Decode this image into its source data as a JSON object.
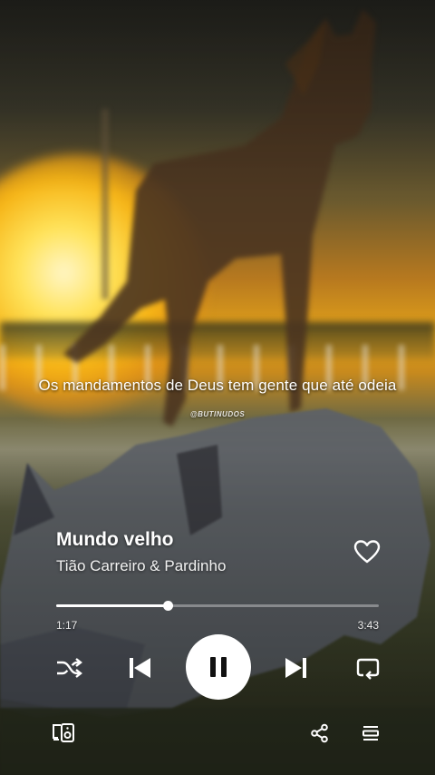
{
  "lyric": {
    "line": "Os mandamentos de Deus tem gente que até odeia"
  },
  "watermark": "@BUTINUDOS",
  "track": {
    "title": "Mundo velho",
    "artist": "Tião Carreiro & Pardinho"
  },
  "progress": {
    "elapsed": "1:17",
    "total": "3:43",
    "fraction": 0.345
  },
  "controls": {
    "shuffle": "shuffle-icon",
    "previous": "skip-previous-icon",
    "play_pause": "pause-icon",
    "next": "skip-next-icon",
    "repeat": "repeat-icon"
  },
  "bottom": {
    "left": "connect-device-icon",
    "share": "share-icon",
    "queue": "queue-icon"
  },
  "colors": {
    "accent": "#ffffff",
    "sunset": "#e2a21a"
  }
}
